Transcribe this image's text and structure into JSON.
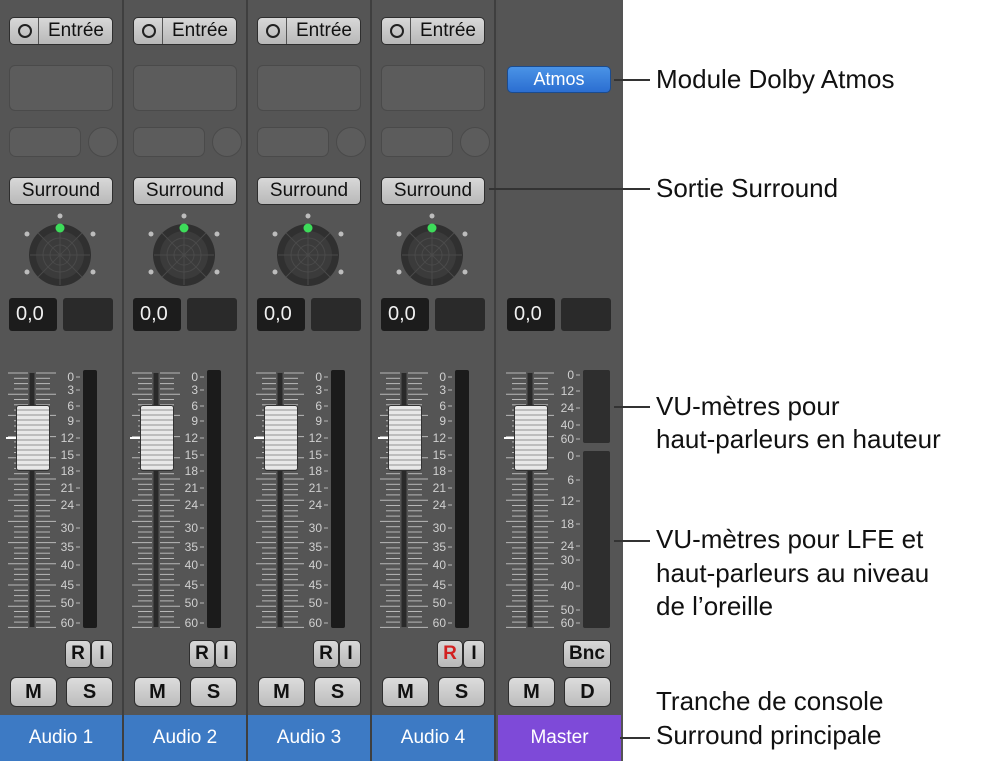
{
  "strips": [
    {
      "input_label": "Entrée",
      "output_label": "Surround",
      "value": "0,0",
      "r_active": false,
      "name": "Audio 1"
    },
    {
      "input_label": "Entrée",
      "output_label": "Surround",
      "value": "0,0",
      "r_active": false,
      "name": "Audio 2"
    },
    {
      "input_label": "Entrée",
      "output_label": "Surround",
      "value": "0,0",
      "r_active": false,
      "name": "Audio 3"
    },
    {
      "input_label": "Entrée",
      "output_label": "Surround",
      "value": "0,0",
      "r_active": true,
      "name": "Audio 4"
    }
  ],
  "master": {
    "plugin_label": "Atmos",
    "value": "0,0",
    "bnc_label": "Bnc",
    "mute_label": "M",
    "dim_label": "D",
    "name": "Master"
  },
  "buttons": {
    "read": "R",
    "input_monitor": "I",
    "mute": "M",
    "solo": "S"
  },
  "scale_labels": [
    "0",
    "3",
    "6",
    "9",
    "12",
    "15",
    "18",
    "21",
    "24",
    "30",
    "35",
    "40",
    "45",
    "50",
    "60"
  ],
  "master_scale_top": [
    "0",
    "12",
    "24",
    "40",
    "60"
  ],
  "master_scale_bottom": [
    "0",
    "6",
    "12",
    "18",
    "24",
    "30",
    "40",
    "50",
    "60"
  ],
  "callouts": {
    "atmos": "Module Dolby Atmos",
    "surround": "Sortie Surround",
    "height_meters_1": "VU-mètres pour",
    "height_meters_2": "haut-parleurs en hauteur",
    "ear_meters_1": "VU-mètres pour LFE et",
    "ear_meters_2": "haut-parleurs au niveau",
    "ear_meters_3": "de l’oreille",
    "master_strip_1": "Tranche de console",
    "master_strip_2": "Surround principale"
  },
  "colors": {
    "strip_name_bg": "#3d7ac4",
    "master_name_bg": "#7e4ad8",
    "atmos_button": "#2b6ed1",
    "panner_dot": "#3ddc5a",
    "read_active": "#d22020"
  }
}
